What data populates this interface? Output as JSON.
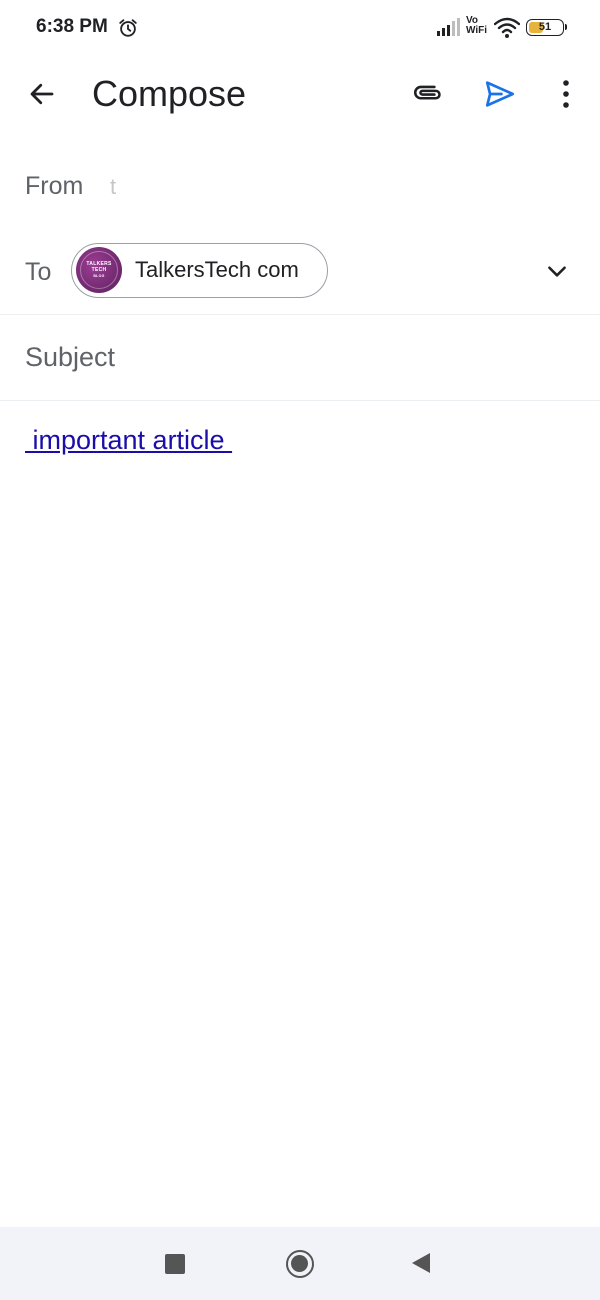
{
  "status_bar": {
    "time": "6:38 PM",
    "vo_line1": "Vo",
    "vo_line2": "WiFi",
    "battery_level": 51,
    "battery_text": "51",
    "battery_color": "#e8b33c",
    "icons": [
      "alarm-icon",
      "signal-icon",
      "vowifi-icon",
      "wifi-icon",
      "battery-icon"
    ]
  },
  "app_bar": {
    "title": "Compose",
    "icons": [
      "back-arrow-icon",
      "attachment-icon",
      "send-icon",
      "more-vert-icon"
    ],
    "accent_color": "#1a73e8"
  },
  "from": {
    "label": "From",
    "value": "t"
  },
  "to": {
    "label": "To",
    "recipient_name": "TalkersTech com",
    "avatar_text_line1": "TALKERS",
    "avatar_text_line2": "TECH",
    "avatar_text_line3": "BLOG",
    "expand_icon": "chevron-down-icon"
  },
  "subject": {
    "placeholder": "Subject",
    "value": ""
  },
  "body": {
    "link_text": " important article "
  },
  "nav_bar": {
    "icons": [
      "recents-square-icon",
      "home-circle-icon",
      "back-triangle-icon"
    ]
  }
}
